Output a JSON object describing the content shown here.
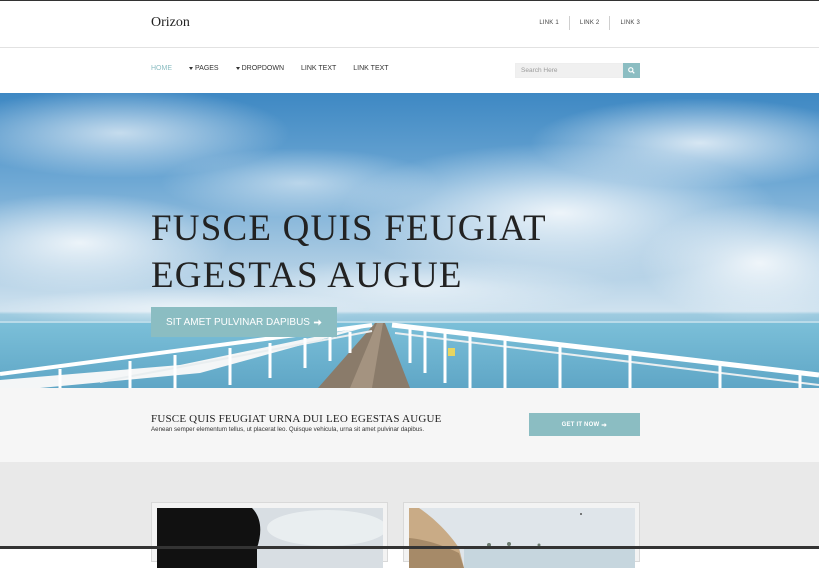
{
  "brand": {
    "name": "Orizon"
  },
  "top_links": [
    "LINK 1",
    "LINK 2",
    "LINK 3"
  ],
  "nav": {
    "items": [
      {
        "label": "HOME",
        "active": true,
        "dropdown": false
      },
      {
        "label": "PAGES",
        "active": false,
        "dropdown": true
      },
      {
        "label": "DROPDOWN",
        "active": false,
        "dropdown": true
      },
      {
        "label": "LINK TEXT",
        "active": false,
        "dropdown": false
      },
      {
        "label": "LINK TEXT",
        "active": false,
        "dropdown": false
      }
    ]
  },
  "search": {
    "placeholder": "Search Here",
    "icon": "search-icon"
  },
  "hero": {
    "title_line1": "FUSCE QUIS FEUGIAT",
    "title_line2": "EGESTAS AUGUE",
    "button_label": "SIT AMET PULVINAR DAPIBUS",
    "button_icon": "arrow-right-icon"
  },
  "cta": {
    "title": "FUSCE QUIS FEUGIAT URNA DUI LEO EGESTAS AUGUE",
    "text": "Aenean semper elementum tellus, ut placerat leo. Quisque vehicula, urna sit amet pulvinar dapibus.",
    "button_label": "GET IT NOW",
    "button_icon": "arrow-right-icon"
  },
  "colors": {
    "accent": "#8bbdc2",
    "text": "#222222",
    "strip": "#f6f6f6",
    "cards_bg": "#e9e9e9"
  }
}
